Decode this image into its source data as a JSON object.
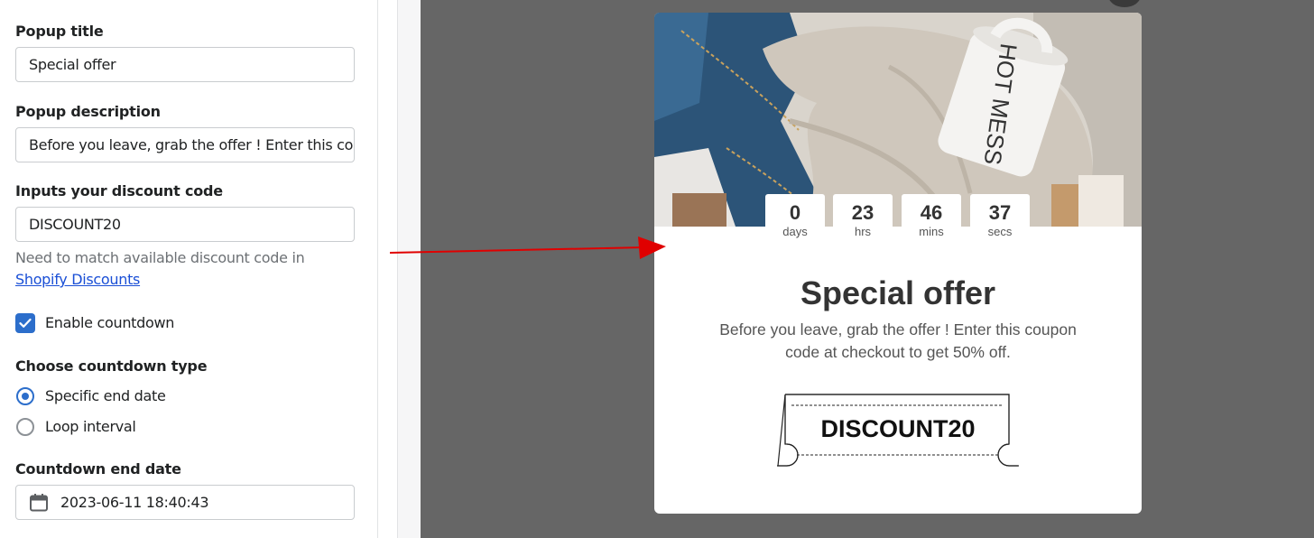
{
  "settings": {
    "popup_title_label": "Popup title",
    "popup_title_value": "Special offer",
    "popup_description_label": "Popup description",
    "popup_description_value": "Before you leave, grab the offer ! Enter this cou",
    "discount_code_label": "Inputs your discount code",
    "discount_code_value": "DISCOUNT20",
    "help_text": "Need to match available discount code in ",
    "help_link": "Shopify Discounts",
    "enable_countdown_label": "Enable countdown",
    "enable_countdown_checked": true,
    "countdown_type_label": "Choose countdown type",
    "countdown_type_options": [
      "Specific end date",
      "Loop interval"
    ],
    "countdown_type_selected": "Specific end date",
    "countdown_end_date_label": "Countdown end date",
    "countdown_end_date_value": "2023-06-11 18:40:43"
  },
  "preview": {
    "countdown": [
      {
        "value": "0",
        "unit": "days"
      },
      {
        "value": "23",
        "unit": "hrs"
      },
      {
        "value": "46",
        "unit": "mins"
      },
      {
        "value": "37",
        "unit": "secs"
      }
    ],
    "title": "Special offer",
    "description": "Before you leave, grab the offer ! Enter this coupon code at checkout to get 50% off.",
    "coupon_code": "DISCOUNT20",
    "mug_text": "HOT MESS"
  },
  "colors": {
    "accent": "#2c6ecb",
    "preview_bg": "#666666",
    "arrow": "#e00000"
  },
  "icons": {
    "checkbox": "check-icon",
    "date": "calendar-icon"
  }
}
